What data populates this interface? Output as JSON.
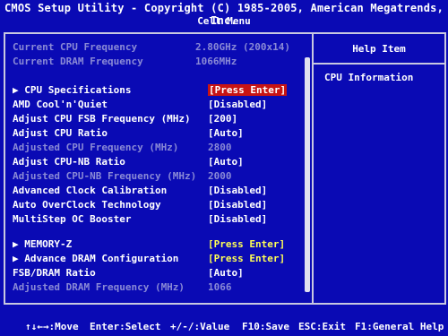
{
  "header": {
    "title_line1": "CMOS Setup Utility - Copyright (C) 1985-2005, American Megatrends, Inc.",
    "title_line2": "Cell Menu"
  },
  "help": {
    "title": "Help Item",
    "text": "CPU Information"
  },
  "rows": [
    {
      "label": "Current CPU Frequency",
      "value": "2.80GHz (200x14)"
    },
    {
      "label": "Current DRAM Frequency",
      "value": "1066MHz"
    },
    {
      "label": "▶ CPU Specifications",
      "value": "[Press Enter]"
    },
    {
      "label": "AMD Cool'n'Quiet",
      "value": "[Disabled]"
    },
    {
      "label": "Adjust CPU FSB Frequency (MHz)",
      "value": "[200]"
    },
    {
      "label": "Adjust CPU Ratio",
      "value": "[Auto]"
    },
    {
      "label": "Adjusted CPU Frequency (MHz)",
      "value": "2800"
    },
    {
      "label": "Adjust CPU-NB Ratio",
      "value": "[Auto]"
    },
    {
      "label": "Adjusted CPU-NB Frequency (MHz)",
      "value": "2000"
    },
    {
      "label": "Advanced Clock Calibration",
      "value": "[Disabled]"
    },
    {
      "label": "Auto OverClock Technology",
      "value": "[Disabled]"
    },
    {
      "label": "MultiStep OC Booster",
      "value": "[Disabled]"
    },
    {
      "label": "▶ MEMORY-Z",
      "value": "[Press Enter]"
    },
    {
      "label": "▶ Advance DRAM Configuration",
      "value": "[Press Enter]"
    },
    {
      "label": "FSB/DRAM Ratio",
      "value": "[Auto]"
    },
    {
      "label": "Adjusted DRAM Frequency (MHz)",
      "value": "1066"
    }
  ],
  "footer": {
    "move": "↑↓←→:Move",
    "select": "Enter:Select",
    "value": "+/-/:Value",
    "save": "F10:Save",
    "exit": "ESC:Exit",
    "help": "F1:General Help"
  },
  "colors": {
    "background": "#0a0ab4",
    "selected": "#c81414",
    "submenu_value": "#ffff55",
    "disabled_text": "#8a8ad6"
  }
}
